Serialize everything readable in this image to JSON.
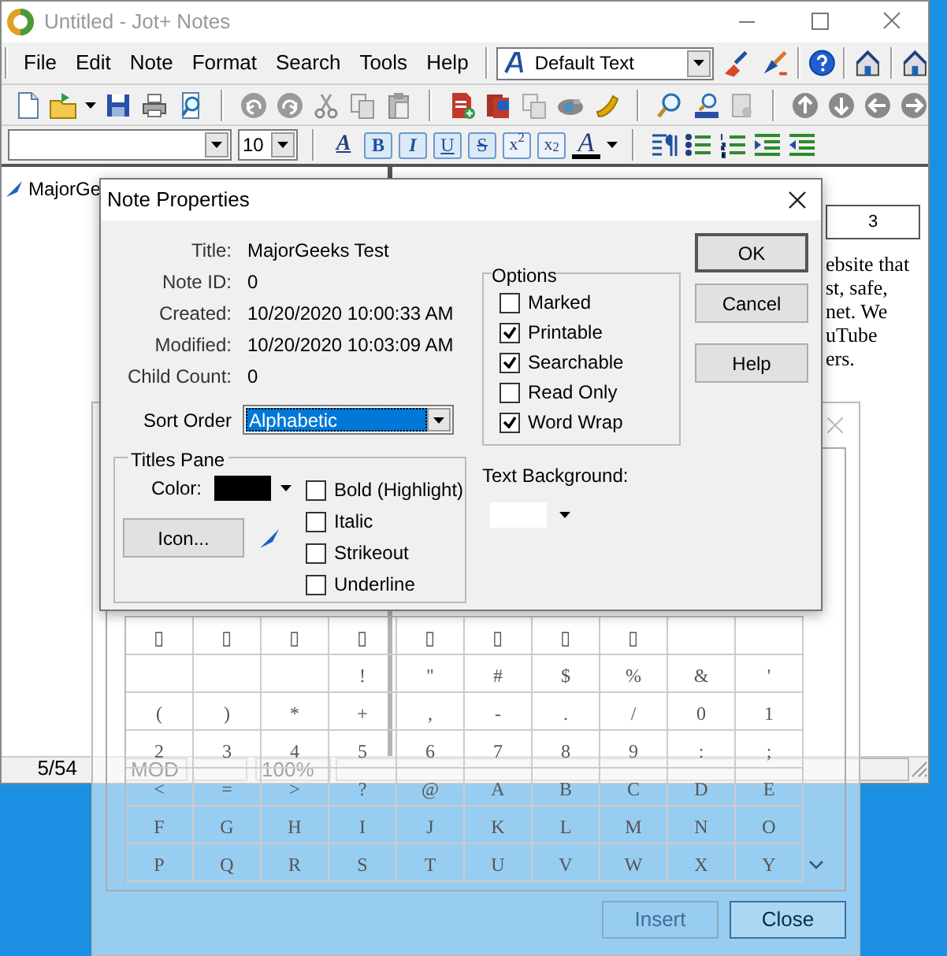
{
  "window": {
    "title": "Untitled - Jot+ Notes"
  },
  "menu": [
    "File",
    "Edit",
    "Note",
    "Format",
    "Search",
    "Tools",
    "Help"
  ],
  "style_box": {
    "value": "Default Text"
  },
  "size_box": {
    "value": "10"
  },
  "format_buttons": [
    {
      "label": "A",
      "kind": "style"
    },
    {
      "label": "B",
      "kind": "bold"
    },
    {
      "label": "I",
      "kind": "italic"
    },
    {
      "label": "U",
      "kind": "underline"
    },
    {
      "label": "S",
      "kind": "strike"
    },
    {
      "label": "x$^{2}$",
      "kind": "script"
    },
    {
      "label": "x$_{2}$",
      "kind": "script"
    },
    {
      "label": "A",
      "kind": "color"
    }
  ],
  "notes_tree": [
    {
      "title": "MajorGe",
      "selected": false
    }
  ],
  "ruler": {
    "mark": "3"
  },
  "editor_lines": [
    "ebsite that",
    "st, safe,",
    "net. We",
    "uTube",
    "ers."
  ],
  "status_bar": {
    "position": "5/54",
    "panels": [
      "MOD",
      "100%"
    ]
  },
  "character_map": {
    "rows": [
      [
        "▯",
        "▯",
        "▯",
        "▯",
        "▯",
        "▯",
        "▯",
        "▯",
        null,
        null
      ],
      [
        null,
        null,
        null,
        "!",
        "\"",
        "#",
        "$",
        "%",
        "&",
        "'"
      ],
      [
        "(",
        ")",
        "*",
        "+",
        ",",
        "-",
        ".",
        "/",
        "0",
        "1"
      ],
      [
        "2",
        "3",
        "4",
        "5",
        "6",
        "7",
        "8",
        "9",
        ":",
        ";"
      ],
      [
        "<",
        "=",
        ">",
        "?",
        "@",
        "A",
        "B",
        "C",
        "D",
        "E"
      ],
      [
        "F",
        "G",
        "H",
        "I",
        "J",
        "K",
        "L",
        "M",
        "N",
        "O"
      ],
      [
        "P",
        "Q",
        "R",
        "S",
        "T",
        "U",
        "V",
        "W",
        "X",
        "Y"
      ]
    ],
    "buttons": [
      {
        "label": "Insert",
        "disabled": true
      },
      {
        "label": "Close",
        "disabled": false
      }
    ]
  },
  "note_properties": {
    "title": "Note Properties",
    "fields": [
      {
        "label": "Title:",
        "value": "MajorGeeks Test"
      },
      {
        "label": "Note ID:",
        "value": "0"
      },
      {
        "label": "Created:",
        "value": "10/20/2020 10:00:33 AM"
      },
      {
        "label": "Modified:",
        "value": "10/20/2020 10:03:09 AM"
      },
      {
        "label": "Child Count:",
        "value": "0"
      }
    ],
    "sort_order": {
      "label": "Sort Order",
      "value": "Alphabetic"
    },
    "titles_pane": {
      "title": "Titles Pane",
      "color_label": "Color:",
      "color": "#000000",
      "icon_button": "Icon...",
      "styles": [
        {
          "label": "Bold (Highlight)",
          "checked": false
        },
        {
          "label": "Italic",
          "checked": false
        },
        {
          "label": "Strikeout",
          "checked": false
        },
        {
          "label": "Underline",
          "checked": false
        }
      ]
    },
    "options": {
      "title": "Options",
      "items": [
        {
          "label": "Marked",
          "checked": false
        },
        {
          "label": "Printable",
          "checked": true
        },
        {
          "label": "Searchable",
          "checked": true
        },
        {
          "label": "Read Only",
          "checked": false
        },
        {
          "label": "Word Wrap",
          "checked": true
        }
      ]
    },
    "text_background": {
      "label": "Text Background:",
      "color": "#ffffff"
    },
    "buttons": [
      "OK",
      "Cancel",
      "Help"
    ]
  }
}
